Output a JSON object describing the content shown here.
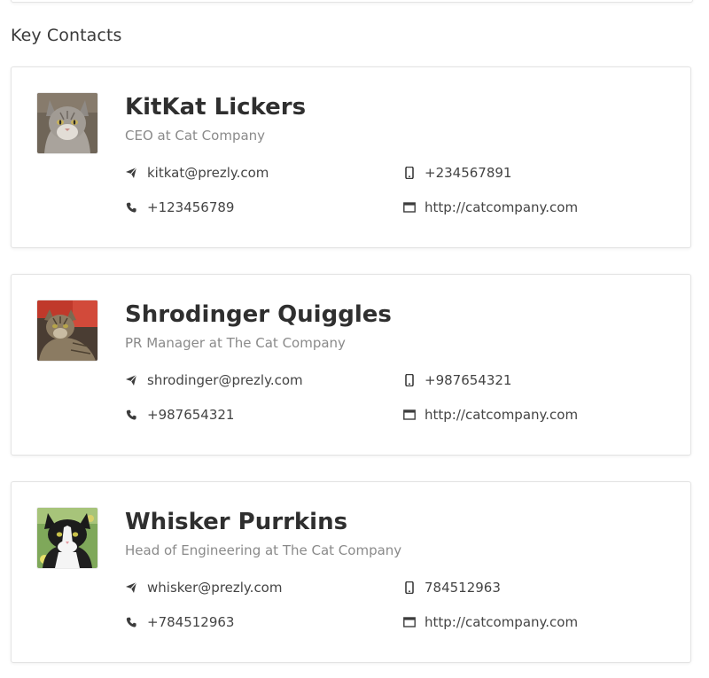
{
  "section": {
    "title": "Key Contacts"
  },
  "contacts": [
    {
      "name": "KitKat Lickers",
      "role": "CEO at Cat Company",
      "email": "kitkat@prezly.com",
      "phone": "+123456789",
      "mobile": "+234567891",
      "website": "http://catcompany.com",
      "avatar": "grey-tabby-cat-photo"
    },
    {
      "name": "Shrodinger Quiggles",
      "role": "PR Manager at The Cat Company",
      "email": "shrodinger@prezly.com",
      "phone": "+987654321",
      "mobile": "+987654321",
      "website": "http://catcompany.com",
      "avatar": "brown-tabby-cat-photo"
    },
    {
      "name": "Whisker Purrkins",
      "role": "Head of Engineering at The Cat Company",
      "email": "whisker@prezly.com",
      "phone": "+784512963",
      "mobile": "784512963",
      "website": "http://catcompany.com",
      "avatar": "black-white-cat-photo"
    }
  ],
  "icons": {
    "email": "send-icon",
    "phone": "phone-icon",
    "mobile": "mobile-icon",
    "website": "browser-window-icon"
  }
}
